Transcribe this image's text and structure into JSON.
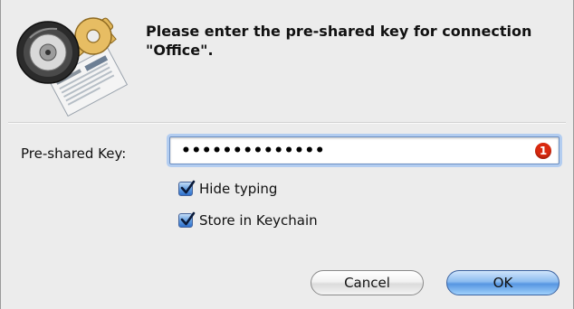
{
  "dialog": {
    "icon": "keychain-access-icon",
    "prompt": "Please enter the pre-shared key for connection \"Office\"."
  },
  "form": {
    "key_label": "Pre-shared Key:",
    "key_value": "••••••••••••••",
    "alert_badge": "1",
    "hide_typing_label": "Hide typing",
    "hide_typing_checked": true,
    "store_keychain_label": "Store in Keychain",
    "store_keychain_checked": true
  },
  "buttons": {
    "cancel_label": "Cancel",
    "ok_label": "OK"
  },
  "colors": {
    "dialog_background": "#ececec",
    "focus_ring": "#b3cdf0",
    "default_button": "#5796e2",
    "alert_badge": "#d9290f"
  }
}
